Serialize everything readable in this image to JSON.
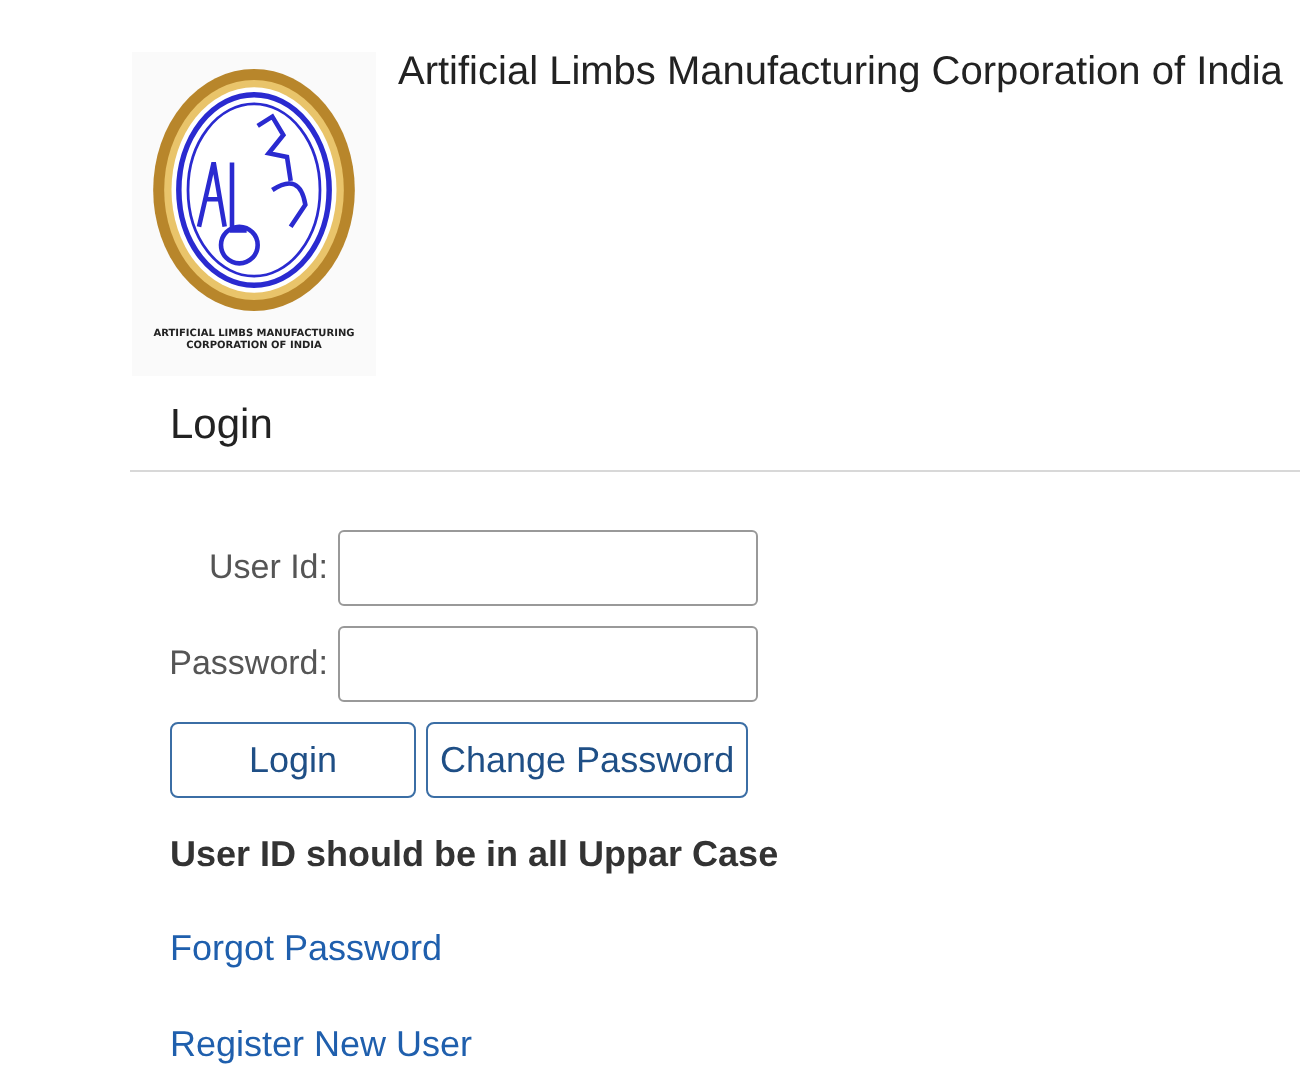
{
  "header": {
    "title": "Artificial Limbs Manufacturing Corporation of India",
    "logo_caption": [
      "ARTIFICIAL LIMBS MANUFACTURING",
      "CORPORATION OF INDIA"
    ]
  },
  "form": {
    "heading": "Login",
    "fields": [
      {
        "label": "User Id:"
      },
      {
        "label": "Password:"
      }
    ],
    "buttons": [
      "Login",
      "Change Password"
    ],
    "note": "User ID should be in all Uppar Case",
    "links": [
      "Forgot Password",
      "Register New User"
    ]
  }
}
